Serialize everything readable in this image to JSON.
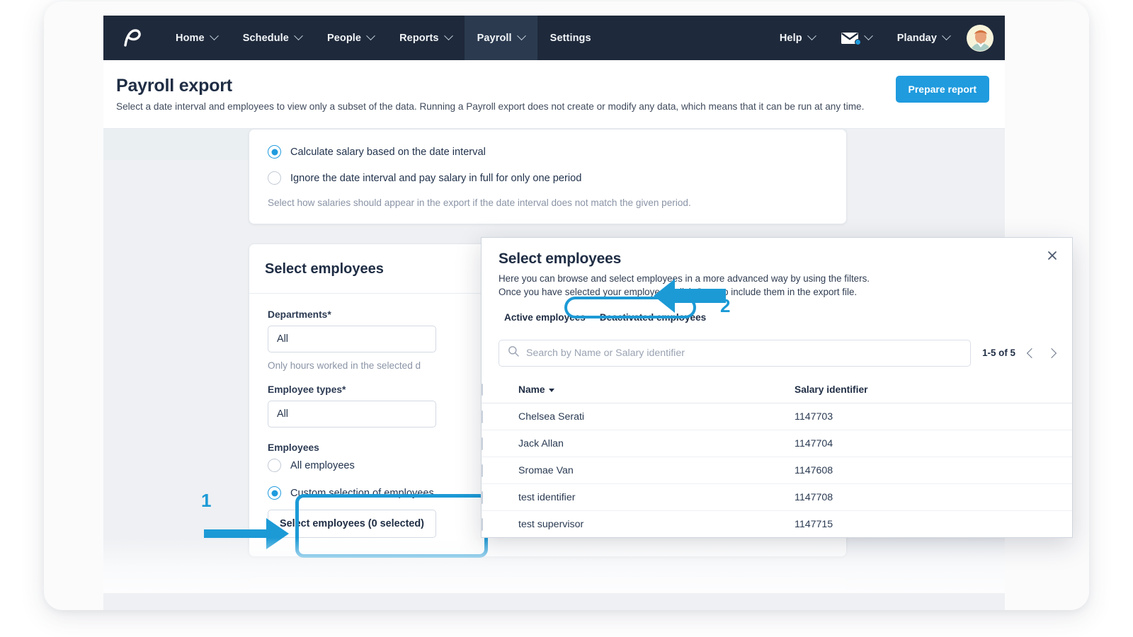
{
  "navbar": {
    "logo_name": "planday-logo",
    "items": [
      {
        "label": "Home",
        "has_caret": true,
        "active": false
      },
      {
        "label": "Schedule",
        "has_caret": true,
        "active": false
      },
      {
        "label": "People",
        "has_caret": true,
        "active": false
      },
      {
        "label": "Reports",
        "has_caret": true,
        "active": false
      },
      {
        "label": "Payroll",
        "has_caret": true,
        "active": true
      },
      {
        "label": "Settings",
        "has_caret": false,
        "active": false
      }
    ],
    "help_label": "Help",
    "account_label": "Planday",
    "mail_icon": "envelope-icon",
    "notification_color": "#1f9bde",
    "avatar_name": "user-avatar"
  },
  "page_header": {
    "title": "Payroll export",
    "description": "Select a date interval and employees to view only a subset of the data. Running a Payroll export does not create or modify any data, which means that it can be run at any time.",
    "prepare_button": "Prepare report"
  },
  "salary_panel": {
    "option_1": "Calculate salary based on the date interval",
    "option_1_selected": true,
    "option_2": "Ignore the date interval and pay salary in full for only one period",
    "option_2_selected": false,
    "hint": "Select how salaries should appear in the export if the date interval does not match the given period."
  },
  "employees_panel": {
    "title": "Select employees",
    "departments_label": "Departments*",
    "departments_value": "All",
    "departments_hint": "Only hours worked in the selected d",
    "employee_types_label": "Employee types*",
    "employee_types_value": "All",
    "employees_label": "Employees",
    "radio_all": "All employees",
    "radio_all_selected": false,
    "radio_custom": "Custom selection of employees",
    "radio_custom_selected": true,
    "select_button": "Select employees (0 selected)"
  },
  "modal": {
    "title": "Select employees",
    "description_line_1": "Here you can browse and select employees in a more advanced way by using the filters.",
    "description_line_2": "Once you have selected your employees, click Save to include them in the export file.",
    "close_icon": "close-icon",
    "tab_active": "Active employees",
    "tab_deactivated": "Deactivated employees",
    "search_placeholder": "Search by Name or Salary identifier",
    "search_value": "",
    "search_icon": "search-icon",
    "pagination_label": "1-5 of 5",
    "prev_icon": "chevron-left-icon",
    "next_icon": "chevron-right-icon",
    "columns": [
      "Name",
      "Salary identifier"
    ],
    "sort_column": "Name",
    "rows": [
      {
        "name": "Chelsea Serati",
        "salary_identifier": "1147703",
        "checked": false
      },
      {
        "name": "Jack Allan",
        "salary_identifier": "1147704",
        "checked": false
      },
      {
        "name": "Sromae Van",
        "salary_identifier": "1147608",
        "checked": false
      },
      {
        "name": "test identifier",
        "salary_identifier": "1147708",
        "checked": false
      },
      {
        "name": "test supervisor",
        "salary_identifier": "1147715",
        "checked": false
      }
    ]
  },
  "annotations": {
    "marker_1": "1",
    "marker_2": "2",
    "accent_color": "#1c9ad6"
  }
}
